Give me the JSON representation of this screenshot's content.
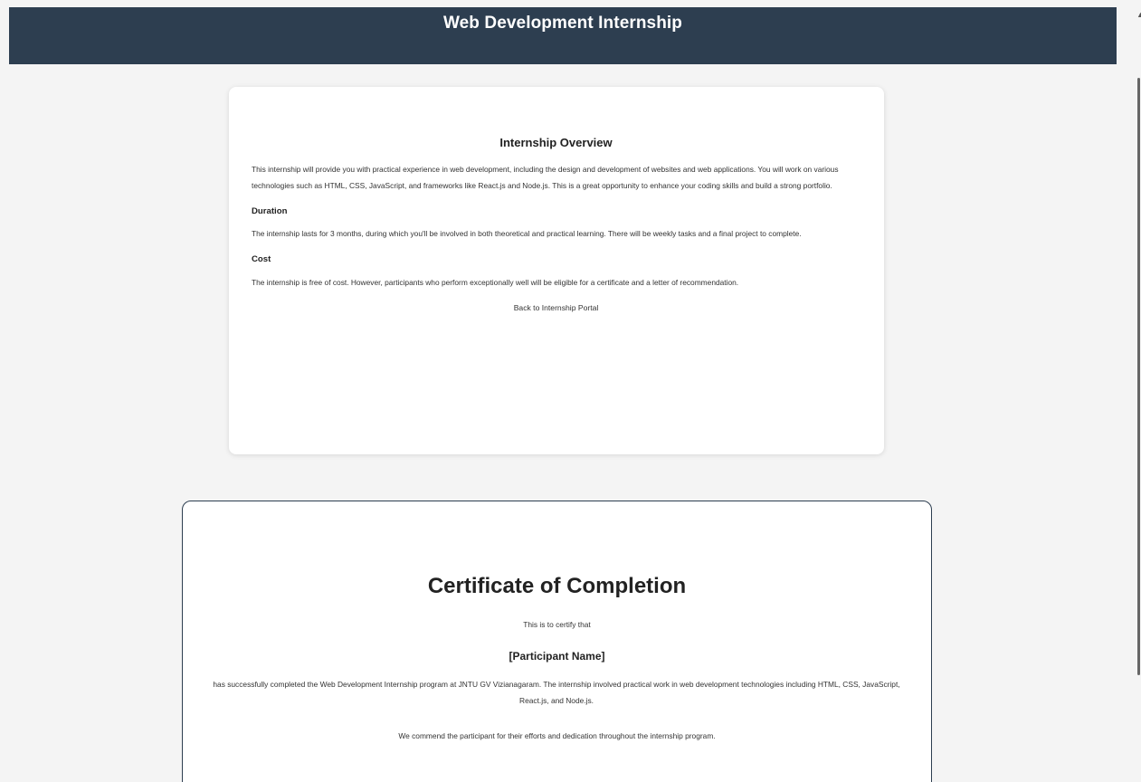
{
  "header": {
    "title": "Web Development Internship"
  },
  "overview": {
    "title": "Internship Overview",
    "intro": "This internship will provide you with practical experience in web development, including the design and development of websites and web applications. You will work on various technologies such as HTML, CSS, JavaScript, and frameworks like React.js and Node.js. This is a great opportunity to enhance your coding skills and build a strong portfolio.",
    "duration_heading": "Duration",
    "duration_text": "The internship lasts for 3 months, during which you'll be involved in both theoretical and practical learning. There will be weekly tasks and a final project to complete.",
    "cost_heading": "Cost",
    "cost_text": "The internship is free of cost. However, participants who perform exceptionally well will be eligible for a certificate and a letter of recommendation.",
    "back_link": "Back to Internship Portal"
  },
  "certificate": {
    "title": "Certificate of Completion",
    "intro": "This is to certify that",
    "participant_name": "[Participant Name]",
    "body": "has successfully completed the Web Development Internship program at JNTU GV Vizianagaram. The internship involved practical work in web development technologies including HTML, CSS, JavaScript, React.js, and Node.js.",
    "commendation": "We commend the participant for their efforts and dedication throughout the internship program."
  },
  "theme": {
    "header_bg": "#2d3e50",
    "page_bg": "#f4f4f4",
    "card_bg": "#ffffff"
  }
}
